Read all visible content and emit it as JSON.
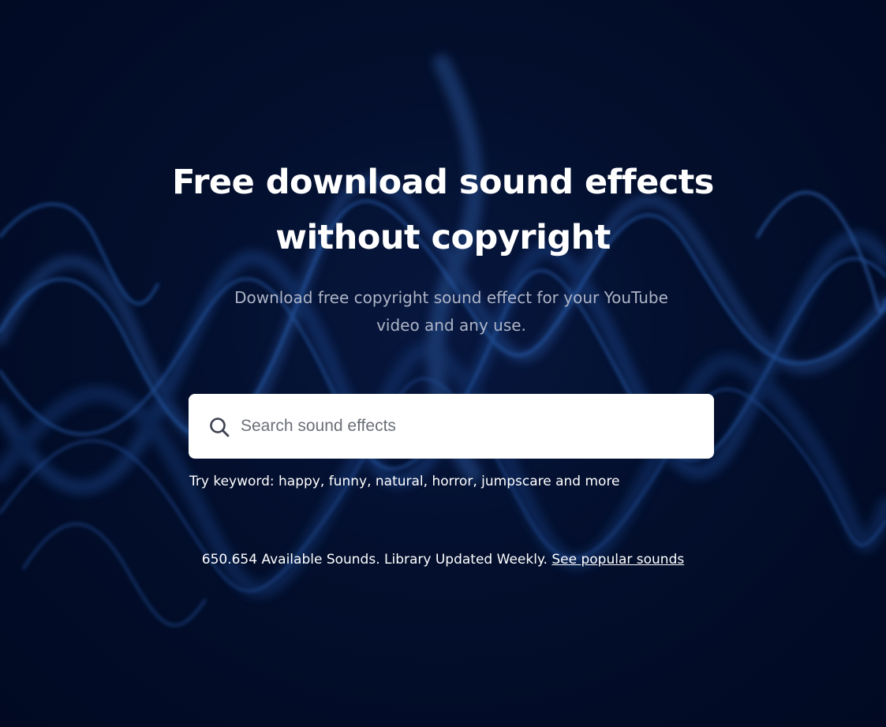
{
  "hero": {
    "title_line1": "Free download sound effects",
    "title_line2": "without copyright",
    "subtitle_line1": "Download free copyright sound effect for your YouTube",
    "subtitle_line2": "video and any use."
  },
  "search": {
    "placeholder": "Search sound effects",
    "icon": "search-icon"
  },
  "keywords": {
    "prefix": "Try keyword:",
    "items": [
      "happy",
      "funny",
      "natural",
      "horror",
      "jumpscare"
    ],
    "suffix": "and more"
  },
  "stats": {
    "text": "650.654 Available Sounds. Library Updated Weekly.",
    "link_label": "See popular sounds"
  },
  "colors": {
    "background": "#020b26",
    "wave_glow": "#1e5fb0",
    "text_primary": "#ffffff",
    "text_muted": "#aeb4c6",
    "search_bg": "#ffffff"
  }
}
